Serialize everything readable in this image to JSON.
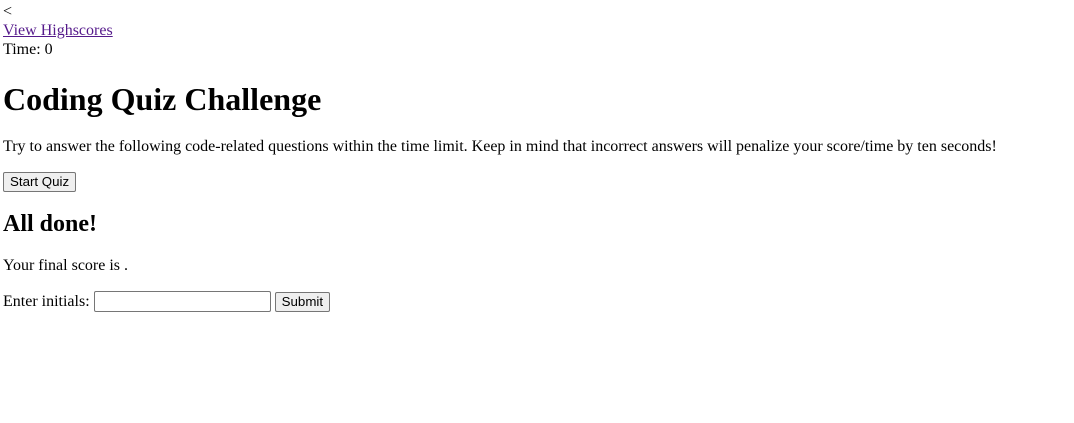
{
  "header": {
    "back_glyph": "<",
    "highscores_link": "View Highscores",
    "timer_label": "Time: ",
    "timer_value": "0"
  },
  "intro": {
    "title": "Coding Quiz Challenge",
    "description": "Try to answer the following code-related questions within the time limit. Keep in mind that incorrect answers will penalize your score/time by ten seconds!",
    "start_button": "Start Quiz"
  },
  "done": {
    "title": "All done!",
    "score_prefix": "Your final score is ",
    "score_value": "",
    "score_suffix": ".",
    "initials_label": "Enter initials:",
    "initials_value": "",
    "submit_button": "Submit"
  },
  "colors": {
    "link_visited": "#551a8b",
    "button_bg": "#efefef",
    "button_border": "#767676"
  }
}
